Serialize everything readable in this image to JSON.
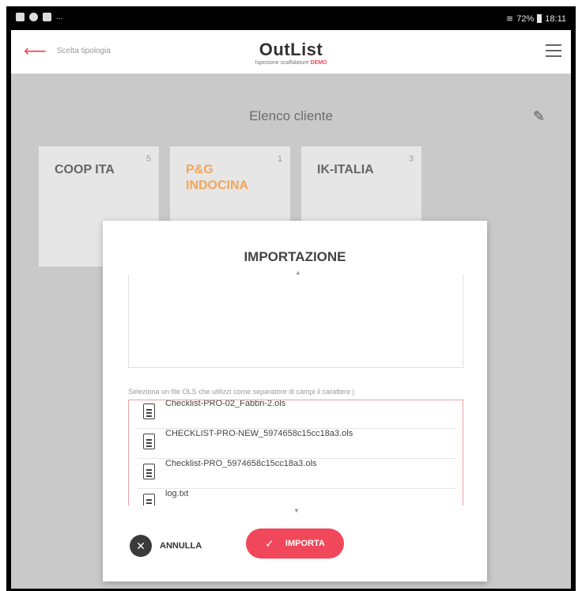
{
  "status_bar": {
    "left_icons": [
      "image-icon",
      "sync-icon",
      "facebook-icon"
    ],
    "left_more": "...",
    "right_text": "72%",
    "time": "18:11"
  },
  "app_bar": {
    "back_label": "Scelta tipologia",
    "brand_name": "OutList",
    "brand_sub": "Ispezione scaffalature",
    "brand_tag": "DEMO"
  },
  "page": {
    "title": "Elenco cliente"
  },
  "clients": [
    {
      "name": "COOP ITA",
      "count": "5",
      "active": false
    },
    {
      "name": "P&G INDOCINA",
      "count": "1",
      "active": true
    },
    {
      "name": "IK-ITALIA",
      "count": "3",
      "active": false
    }
  ],
  "modal": {
    "title": "IMPORTAZIONE",
    "instruction": "Seleziona un file OLS che utilizzi come separatore di campi il carattere |",
    "files": [
      "Checklist-PRO-02_Fabbri-2.ols",
      "CHECKLIST-PRO-NEW_5974658c15cc18a3.ols",
      "Checklist-PRO_5974658c15cc18a3.ols",
      "log.txt"
    ],
    "cancel_label": "ANNULLA",
    "import_label": "IMPORTA"
  },
  "colors": {
    "accent": "#f0485a",
    "active_card": "#f2a65a",
    "background": "#c9c9c9"
  }
}
